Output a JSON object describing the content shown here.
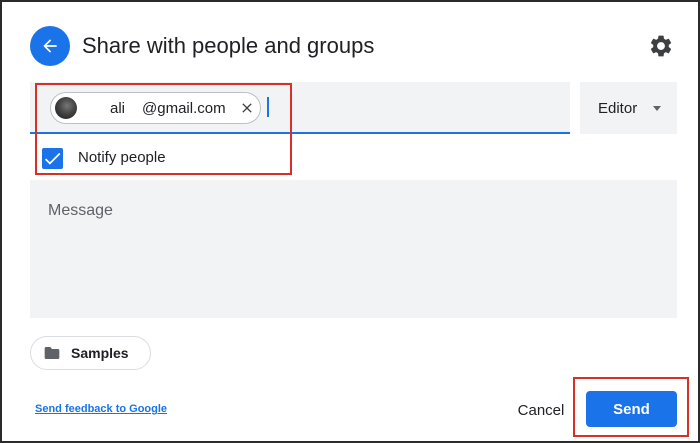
{
  "header": {
    "title": "Share with people and groups",
    "back_icon": "arrow-left-icon",
    "settings_icon": "gear-icon"
  },
  "recipient": {
    "chip": {
      "name": "ali",
      "domain": "@gmail.com",
      "avatar_icon": "avatar-photo",
      "close_icon": "close-icon"
    },
    "role": {
      "selected": "Editor",
      "dropdown_icon": "triangle-down-icon"
    }
  },
  "notify": {
    "checked": true,
    "label": "Notify people"
  },
  "message": {
    "placeholder": "Message"
  },
  "folder": {
    "label": "Samples",
    "icon": "folder-icon"
  },
  "footer": {
    "feedback_link": "Send feedback to Google",
    "cancel_label": "Cancel",
    "send_label": "Send"
  },
  "colors": {
    "accent": "#1a73e8",
    "highlight_box": "#d93025",
    "field_bg": "#f1f3f4",
    "text": "#202124",
    "muted_text": "#5f6368"
  }
}
